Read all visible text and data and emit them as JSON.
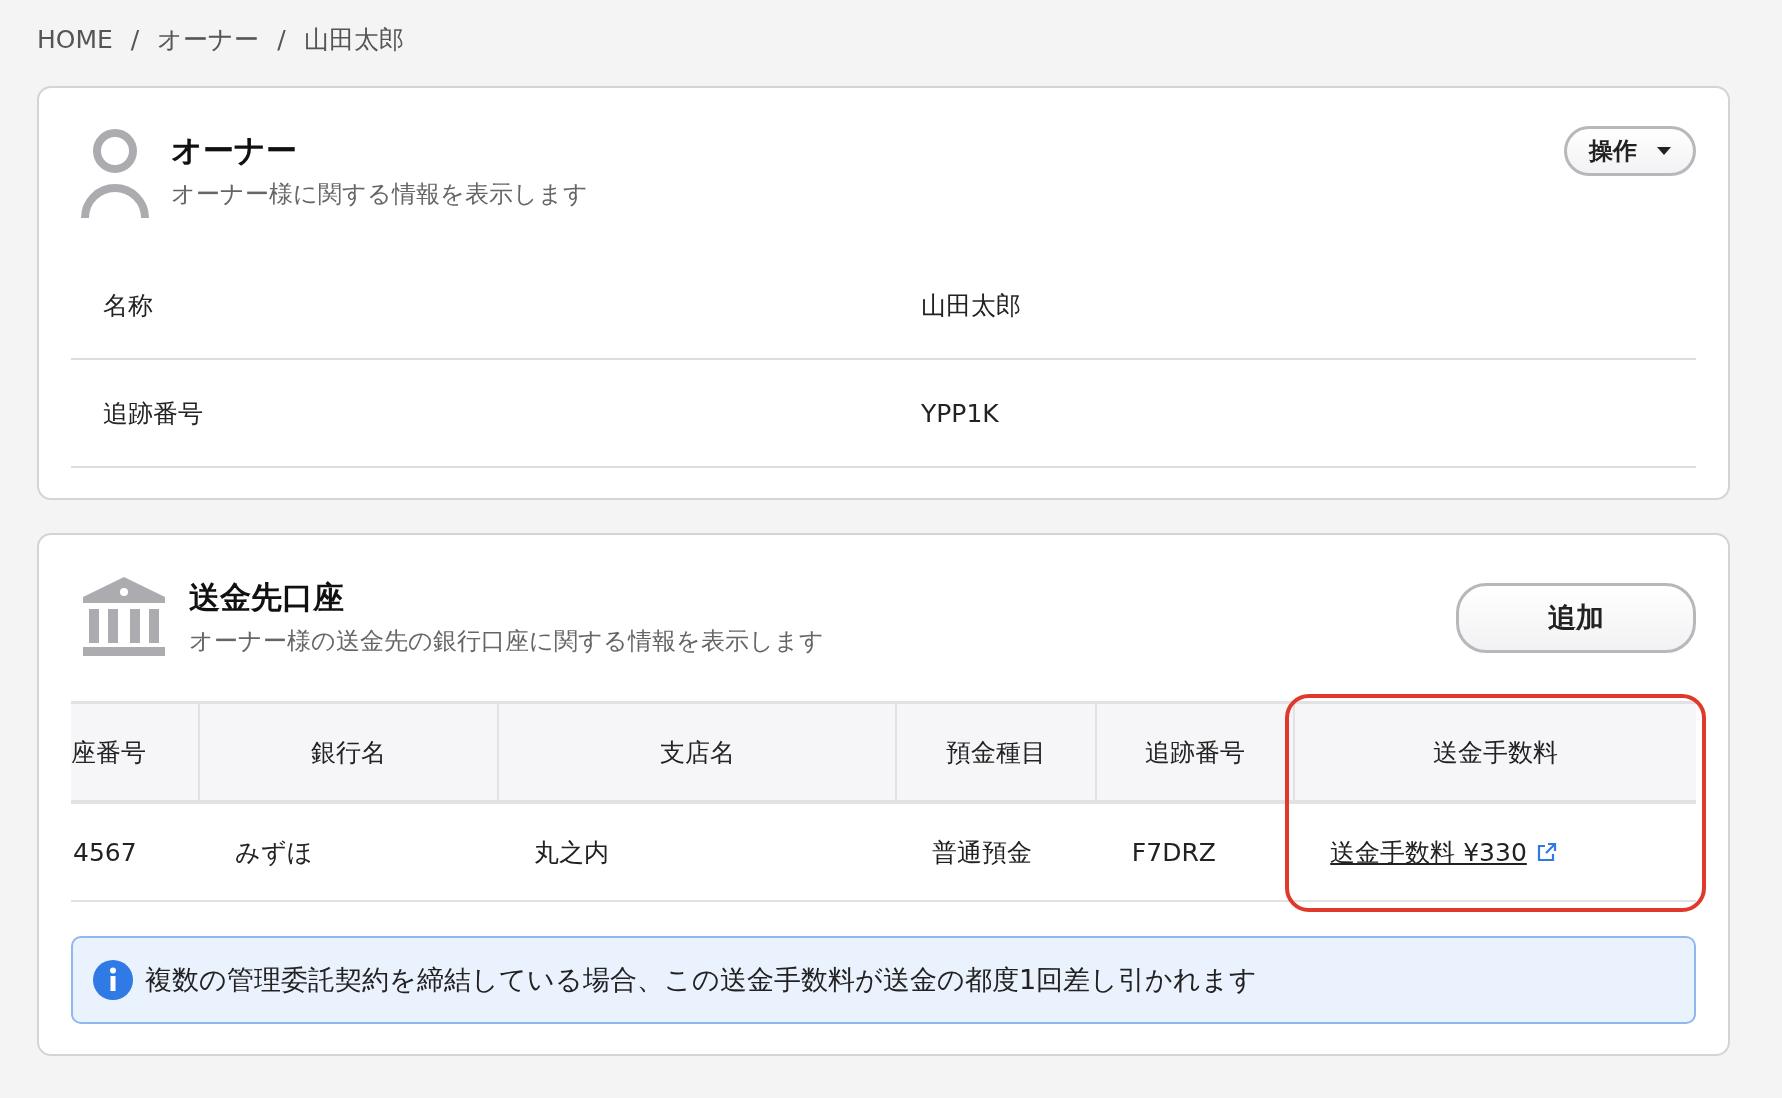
{
  "breadcrumb": {
    "items": [
      "HOME",
      "オーナー",
      "山田太郎"
    ],
    "separator": "/"
  },
  "owner_card": {
    "title": "オーナー",
    "subtitle": "オーナー様に関する情報を表示します",
    "menu_button": "操作",
    "fields": [
      {
        "label": "名称",
        "value": "山田太郎"
      },
      {
        "label": "追跡番号",
        "value": "YPP1K"
      }
    ]
  },
  "account_card": {
    "title": "送金先口座",
    "subtitle": "オーナー様の送金先の銀行口座に関する情報を表示します",
    "add_button": "追加",
    "table": {
      "columns": [
        {
          "label": "座番号",
          "highlighted": false
        },
        {
          "label": "銀行名",
          "highlighted": false
        },
        {
          "label": "支店名",
          "highlighted": false
        },
        {
          "label": "預金種目",
          "highlighted": false
        },
        {
          "label": "追跡番号",
          "highlighted": false
        },
        {
          "label": "送金手数料",
          "highlighted": true
        }
      ],
      "rows": [
        {
          "cells": [
            {
              "kind": "text",
              "text": "4567"
            },
            {
              "kind": "text",
              "text": "みずほ"
            },
            {
              "kind": "text",
              "text": "丸之内"
            },
            {
              "kind": "text",
              "text": "普通預金"
            },
            {
              "kind": "text",
              "text": "F7DRZ"
            },
            {
              "kind": "link",
              "text": "送金手数料 ¥330"
            }
          ]
        }
      ]
    },
    "notice": "複数の管理委託契約を締結している場合、この送金手数料が送金の都度1回差し引かれます"
  }
}
